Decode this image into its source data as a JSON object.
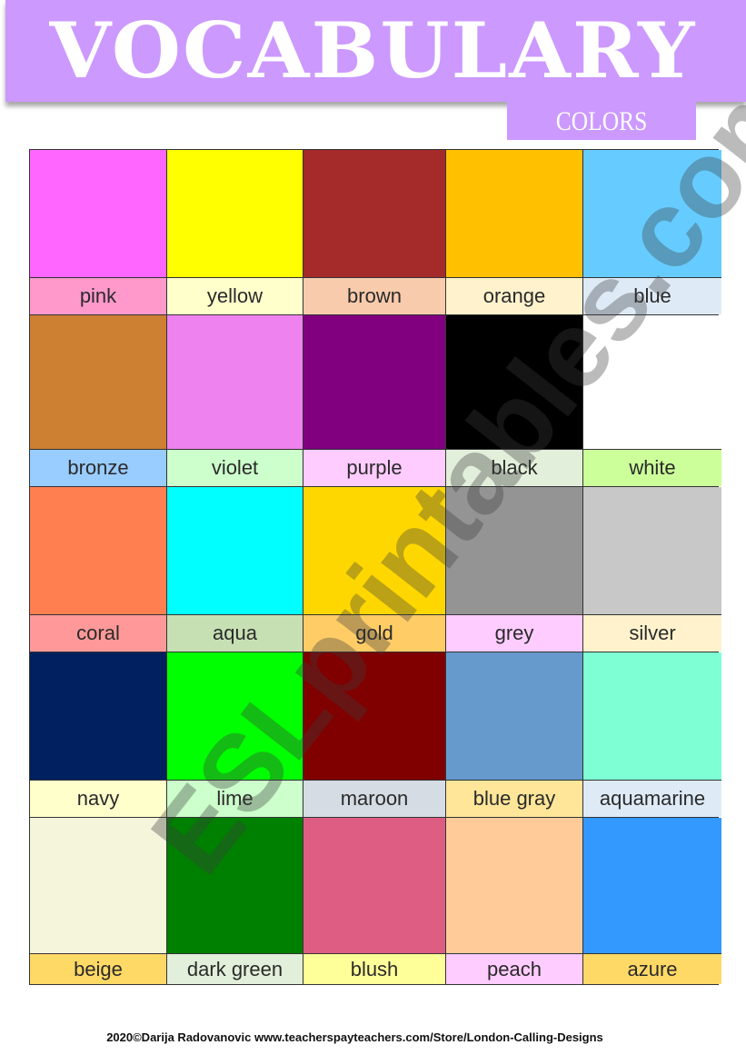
{
  "header": {
    "title": "VOCABULARY",
    "subtitle": "COLORS",
    "banner_color": "#cc99ff"
  },
  "colors": [
    {
      "name": "pink",
      "swatch": "#ff66ff",
      "label_bg": "#ff99cc"
    },
    {
      "name": "yellow",
      "swatch": "#ffff00",
      "label_bg": "#ffffcc"
    },
    {
      "name": "brown",
      "swatch": "#a52a2a",
      "label_bg": "#f8cbad"
    },
    {
      "name": "orange",
      "swatch": "#ffc000",
      "label_bg": "#fff2cc"
    },
    {
      "name": "blue",
      "swatch": "#66ccff",
      "label_bg": "#deebf7"
    },
    {
      "name": "bronze",
      "swatch": "#cd7f32",
      "label_bg": "#99ccff"
    },
    {
      "name": "violet",
      "swatch": "#ee82ee",
      "label_bg": "#ccffcc"
    },
    {
      "name": "purple",
      "swatch": "#800080",
      "label_bg": "#ffccff"
    },
    {
      "name": "black",
      "swatch": "#000000",
      "label_bg": "#e2efda"
    },
    {
      "name": "white",
      "swatch": "#ffffff",
      "label_bg": "#ccff99"
    },
    {
      "name": "coral",
      "swatch": "#ff7f50",
      "label_bg": "#ff9999"
    },
    {
      "name": "aqua",
      "swatch": "#00ffff",
      "label_bg": "#c6e0b4"
    },
    {
      "name": "gold",
      "swatch": "#ffd700",
      "label_bg": "#ffcc66"
    },
    {
      "name": "grey",
      "swatch": "#949494",
      "label_bg": "#ffccff"
    },
    {
      "name": "silver",
      "swatch": "#c8c8c8",
      "label_bg": "#fff2cc"
    },
    {
      "name": "navy",
      "swatch": "#002060",
      "label_bg": "#ffffcc"
    },
    {
      "name": "lime",
      "swatch": "#00ff00",
      "label_bg": "#ccffcc"
    },
    {
      "name": "maroon",
      "swatch": "#800000",
      "label_bg": "#d6dce4"
    },
    {
      "name": "blue gray",
      "swatch": "#6699cc",
      "label_bg": "#ffe699"
    },
    {
      "name": "aquamarine",
      "swatch": "#7fffd4",
      "label_bg": "#deebf7"
    },
    {
      "name": "beige",
      "swatch": "#f5f5dc",
      "label_bg": "#ffd966"
    },
    {
      "name": "dark green",
      "swatch": "#008000",
      "label_bg": "#e2efda"
    },
    {
      "name": "blush",
      "swatch": "#de5d83",
      "label_bg": "#ffff99"
    },
    {
      "name": "peach",
      "swatch": "#ffcc99",
      "label_bg": "#ffccff"
    },
    {
      "name": "azure",
      "swatch": "#3399ff",
      "label_bg": "#ffd966"
    }
  ],
  "watermark": "ESLprintables.com",
  "footer": "2020©Darija Radovanovic   www.teacherspayteachers.com/Store/London-Calling-Designs"
}
